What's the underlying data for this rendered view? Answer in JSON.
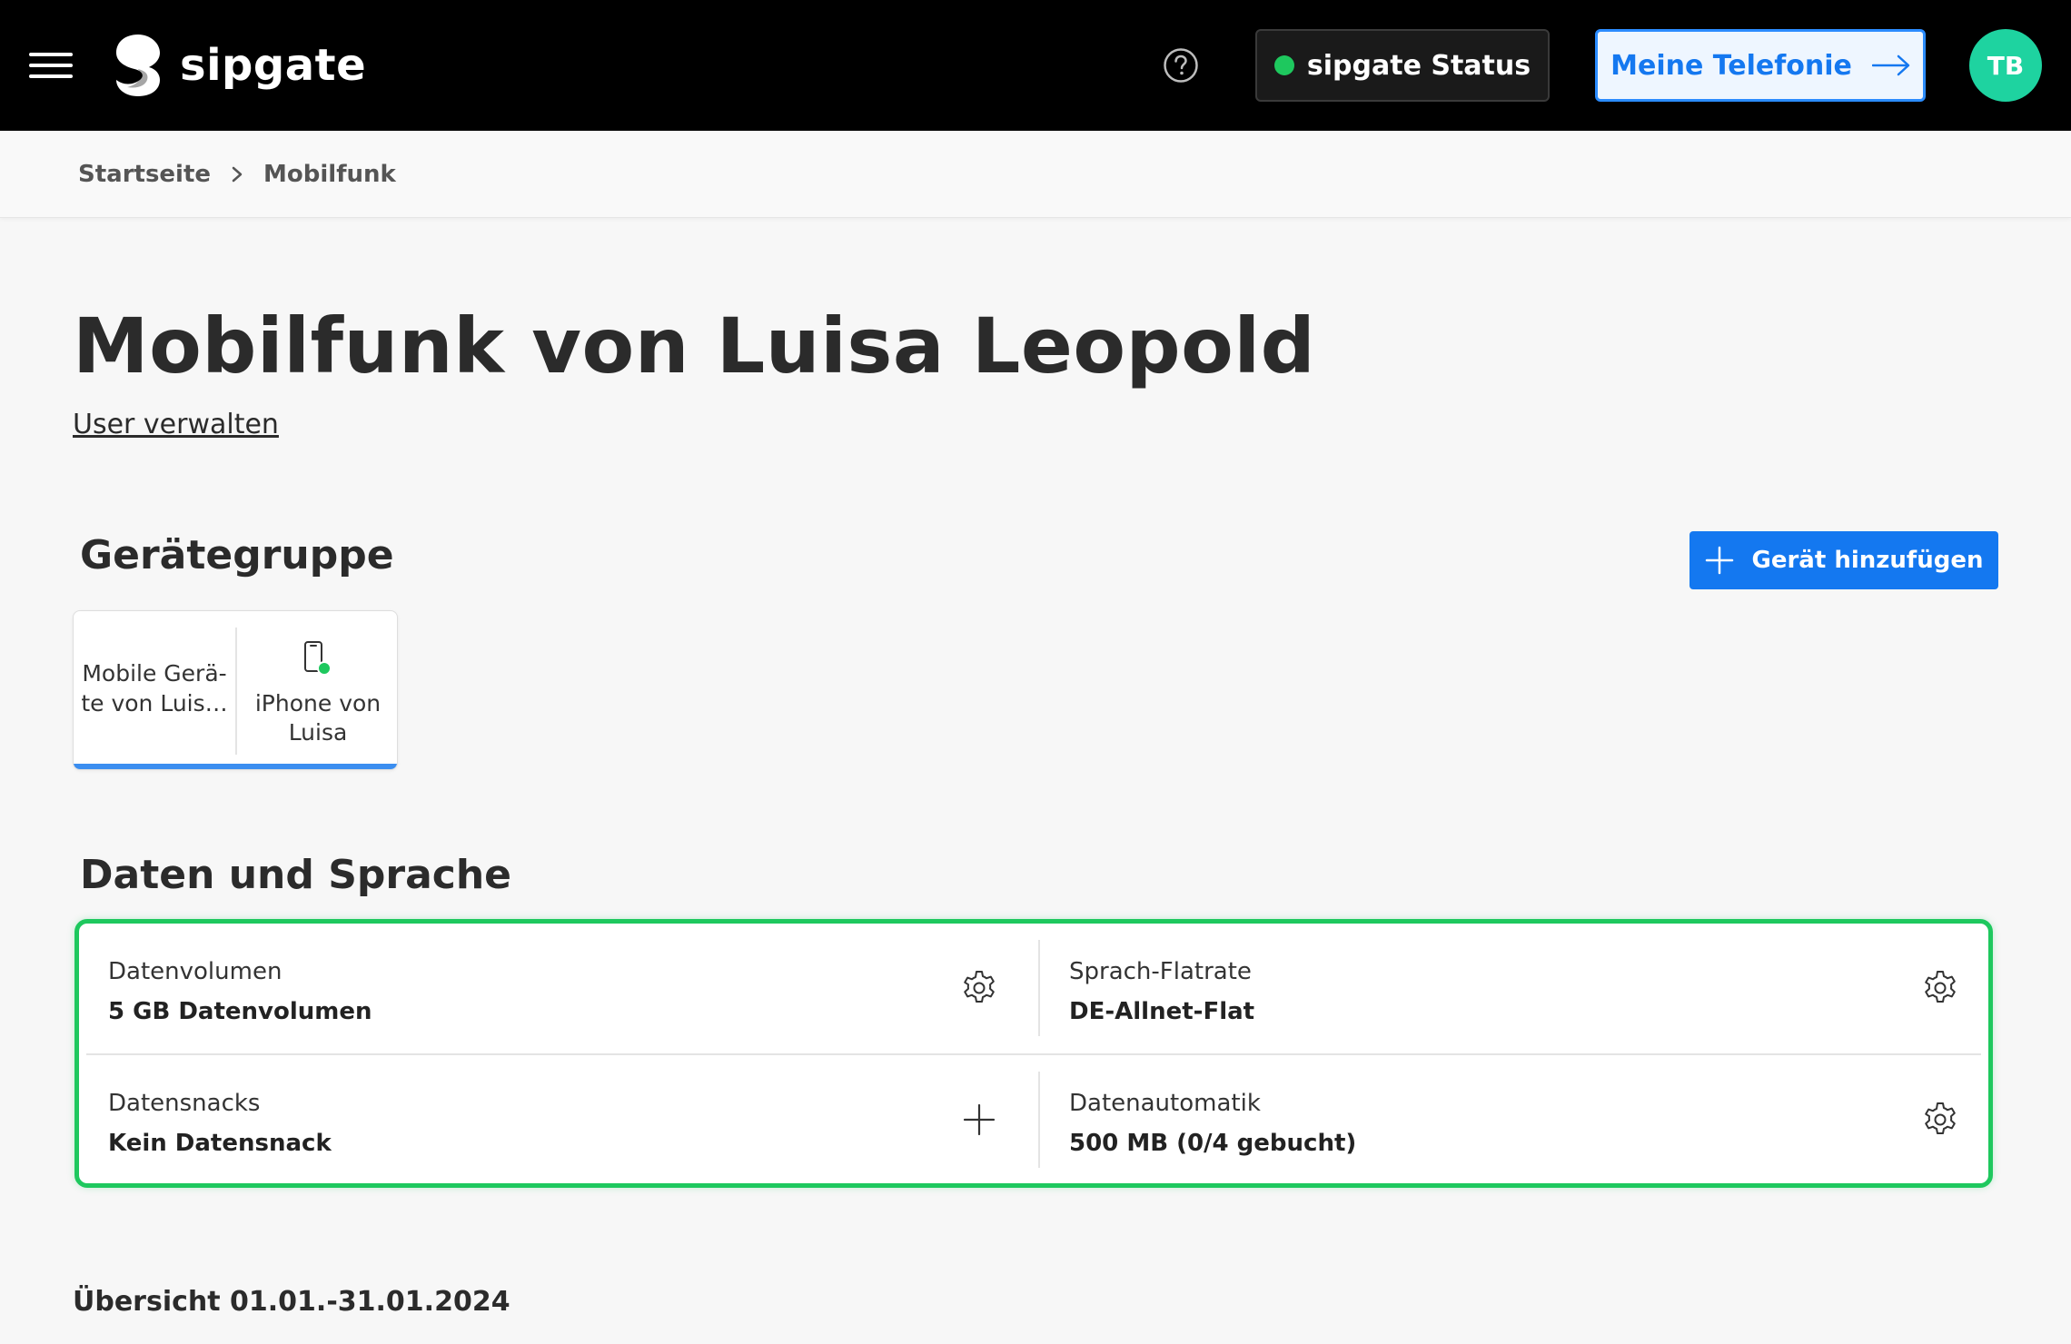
{
  "header": {
    "logo_text": "sipgate",
    "status_label": "sipgate Status",
    "telefonie_label": "Meine Telefonie",
    "avatar_initials": "TB",
    "status_color": "#1ec85e",
    "accent_color": "#1478f0",
    "avatar_color": "#1ed3a0",
    "icons": [
      "menu-icon",
      "sipgate-logo",
      "help-icon",
      "status-dot",
      "arrow-right-icon"
    ]
  },
  "breadcrumb": {
    "items": [
      "Startseite",
      "Mobilfunk"
    ]
  },
  "page": {
    "title": "Mobilfunk von Luisa Leopold",
    "manage_users_link": "User verwalten"
  },
  "device_group": {
    "section_title": "Gerätegruppe",
    "add_button_label": "Gerät hinzufügen",
    "group_label_line1": "Mobile Gerä-",
    "group_label_line2": "te von Luis…",
    "device_name_line1": "iPhone von",
    "device_name_line2": "Luisa",
    "device_status_color": "#1ec85e"
  },
  "data_speech": {
    "section_title": "Daten und Sprache",
    "highlight_color": "#1ec85e",
    "cells": [
      {
        "label": "Datenvolumen",
        "value": "5 GB Datenvolumen",
        "action_icon": "gear-icon"
      },
      {
        "label": "Sprach-Flatrate",
        "value": "DE-Allnet-Flat",
        "action_icon": "gear-icon"
      },
      {
        "label": "Datensnacks",
        "value": "Kein Datensnack",
        "action_icon": "plus-icon"
      },
      {
        "label": "Datenautomatik",
        "value": "500 MB (0/4 gebucht)",
        "action_icon": "gear-icon"
      }
    ]
  },
  "overview": {
    "title": "Übersicht 01.01.-31.01.2024"
  }
}
